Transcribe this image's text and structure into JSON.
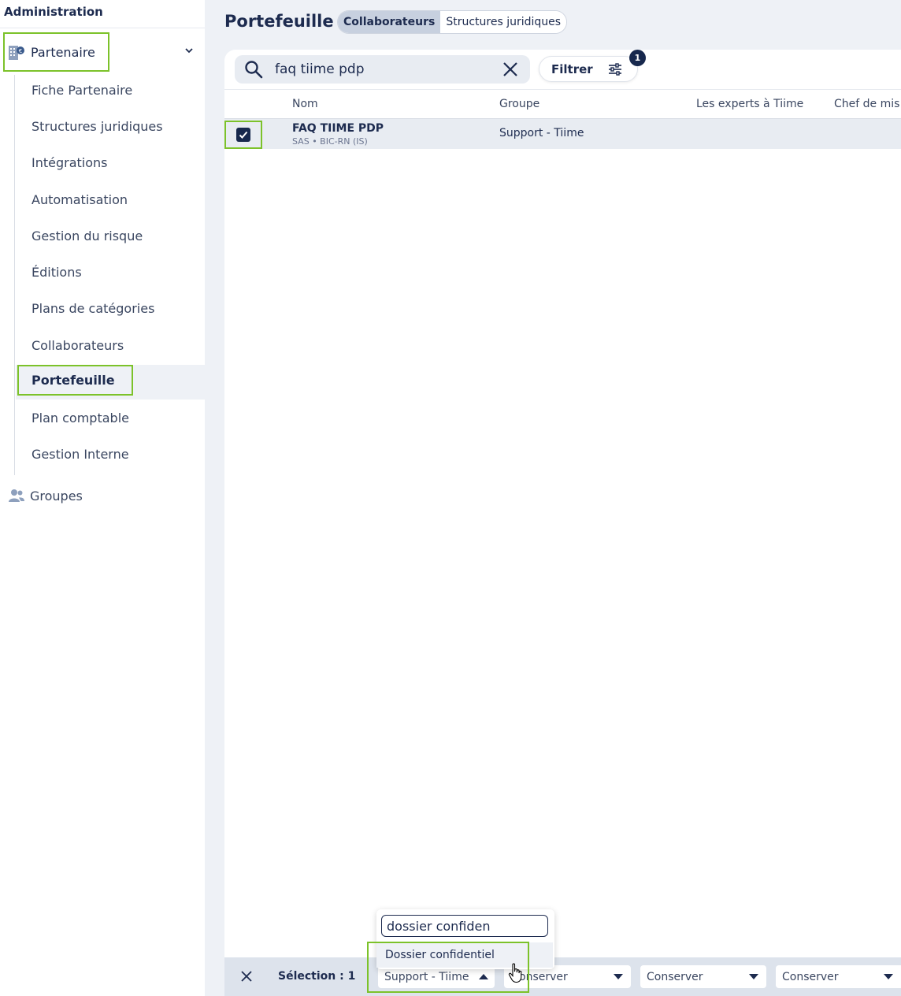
{
  "sidebar": {
    "title": "Administration",
    "partner": "Partenaire",
    "items": [
      "Fiche Partenaire",
      "Structures juridiques",
      "Intégrations",
      "Automatisation",
      "Gestion du risque",
      "Éditions",
      "Plans de catégories",
      "Collaborateurs",
      "Portefeuille",
      "Plan comptable",
      "Gestion Interne"
    ],
    "groups": "Groupes"
  },
  "header": {
    "title": "Portefeuille",
    "tabs": [
      "Collaborateurs",
      "Structures juridiques"
    ]
  },
  "toolbar": {
    "search_value": "faq tiime pdp",
    "filter_label": "Filtrer",
    "filter_count": "1"
  },
  "table": {
    "columns": [
      "Nom",
      "Groupe",
      "Les experts à Tiime",
      "Chef de mis"
    ],
    "rows": [
      {
        "name": "FAQ TIIME PDP",
        "sub": "SAS • BIC-RN (IS)",
        "group": "Support - Tiime",
        "checked": true
      }
    ]
  },
  "bottom_bar": {
    "selection": "Sélection : 1",
    "dropdowns": [
      "Support - Tiime",
      "Conserver",
      "Conserver",
      "Conserver"
    ],
    "first_dropdown_hidden_text": "onserver"
  },
  "popup": {
    "search_value": "dossier confiden",
    "option": "Dossier confidentiel"
  },
  "colors": {
    "highlight": "#7cc22a",
    "navy": "#17284d",
    "main_bg": "#eef1f6"
  }
}
